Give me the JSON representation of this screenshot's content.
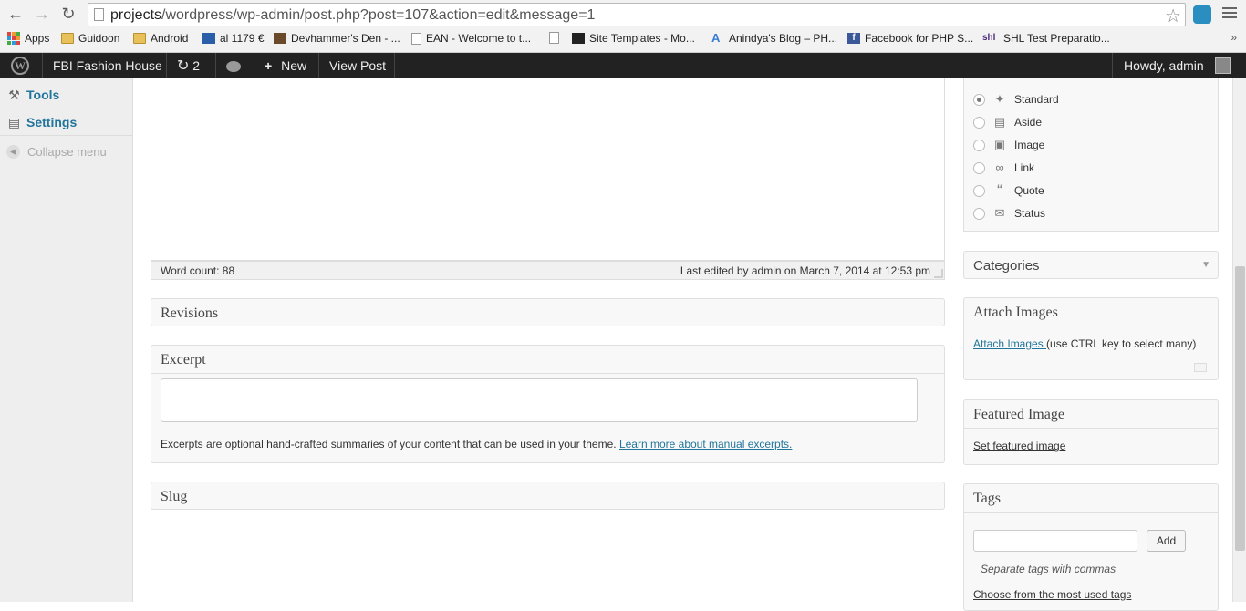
{
  "browser": {
    "url_prefix": "projects",
    "url_rest": "/wordpress/wp-admin/post.php?post=107&action=edit&message=1",
    "bookmarks": [
      {
        "label": "Apps",
        "icon": "apps-grid-icon"
      },
      {
        "label": "Guidoon",
        "icon": "folder-icon"
      },
      {
        "label": "Android",
        "icon": "folder-icon"
      },
      {
        "label": "al 1179 €",
        "icon": "site-favicon"
      },
      {
        "label": "Devhammer's Den - ...",
        "icon": "site-favicon"
      },
      {
        "label": "EAN - Welcome to t...",
        "icon": "page-icon"
      },
      {
        "label": "",
        "icon": "page-icon"
      },
      {
        "label": "Site Templates - Mo...",
        "icon": "site-favicon"
      },
      {
        "label": "Anindya's Blog – PH...",
        "icon": "site-favicon"
      },
      {
        "label": "Facebook for PHP S...",
        "icon": "facebook-icon"
      },
      {
        "label": "SHL Test Preparatio...",
        "icon": "site-favicon"
      }
    ],
    "more": "»"
  },
  "adminbar": {
    "site_name": "FBI Fashion House",
    "updates_count": "2",
    "new_label": "New",
    "view_post_label": "View Post",
    "howdy": "Howdy, admin"
  },
  "sidemenu": {
    "tools": "Tools",
    "settings": "Settings",
    "collapse": "Collapse menu"
  },
  "editor": {
    "word_count": "Word count: 88",
    "last_edited": "Last edited by admin on March 7, 2014 at 12:53 pm"
  },
  "boxes": {
    "revisions": "Revisions",
    "excerpt": "Excerpt",
    "excerpt_help": "Excerpts are optional hand-crafted summaries of your content that can be used in your theme.",
    "excerpt_link": "Learn more about manual excerpts.",
    "slug": "Slug"
  },
  "format": {
    "options": [
      "Standard",
      "Aside",
      "Image",
      "Link",
      "Quote",
      "Status"
    ],
    "selected": "Standard"
  },
  "sidebar": {
    "categories": "Categories",
    "attach_images_title": "Attach Images",
    "attach_images_link": "Attach Images ",
    "attach_images_hint": "(use CTRL key to select many)",
    "featured_image_title": "Featured Image",
    "featured_image_link": "Set featured image",
    "tags_title": "Tags",
    "tags_add": "Add",
    "tags_hint": "Separate tags with commas",
    "tags_most_used": "Choose from the most used tags"
  }
}
